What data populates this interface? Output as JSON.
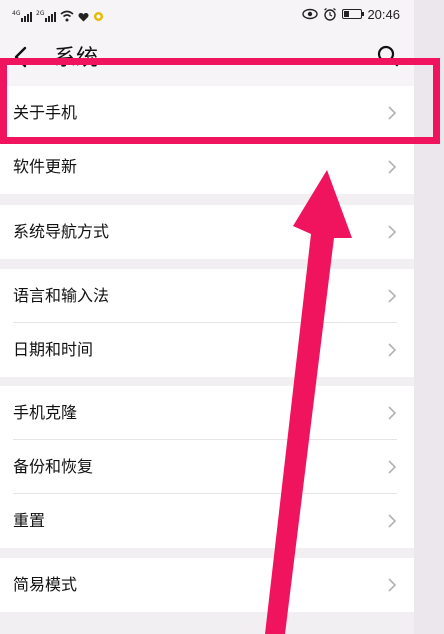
{
  "status_bar": {
    "signal1_tag": "4G",
    "signal2_tag": "2G",
    "time": "20:46",
    "icons": [
      "signal-icon",
      "signal-icon",
      "wifi-icon",
      "heart-icon",
      "notification-icon",
      "eye-icon",
      "alarm-icon",
      "battery-icon"
    ]
  },
  "header": {
    "title": "系统",
    "back_icon": "back-arrow-icon",
    "search_icon": "search-icon"
  },
  "groups": [
    {
      "items": [
        {
          "label": "关于手机",
          "icon": "chevron-right-icon"
        },
        {
          "label": "软件更新",
          "icon": "chevron-right-icon"
        }
      ]
    },
    {
      "items": [
        {
          "label": "系统导航方式",
          "icon": "chevron-right-icon"
        }
      ]
    },
    {
      "items": [
        {
          "label": "语言和输入法",
          "icon": "chevron-right-icon"
        },
        {
          "label": "日期和时间",
          "icon": "chevron-right-icon"
        }
      ]
    },
    {
      "items": [
        {
          "label": "手机克隆",
          "icon": "chevron-right-icon"
        },
        {
          "label": "备份和恢复",
          "icon": "chevron-right-icon"
        },
        {
          "label": "重置",
          "icon": "chevron-right-icon"
        }
      ]
    },
    {
      "items": [
        {
          "label": "简易模式",
          "icon": "chevron-right-icon"
        }
      ]
    }
  ],
  "colors": {
    "annotation": "#f0145e",
    "page_background": "#f2eff3",
    "card_background": "#ffffff"
  }
}
